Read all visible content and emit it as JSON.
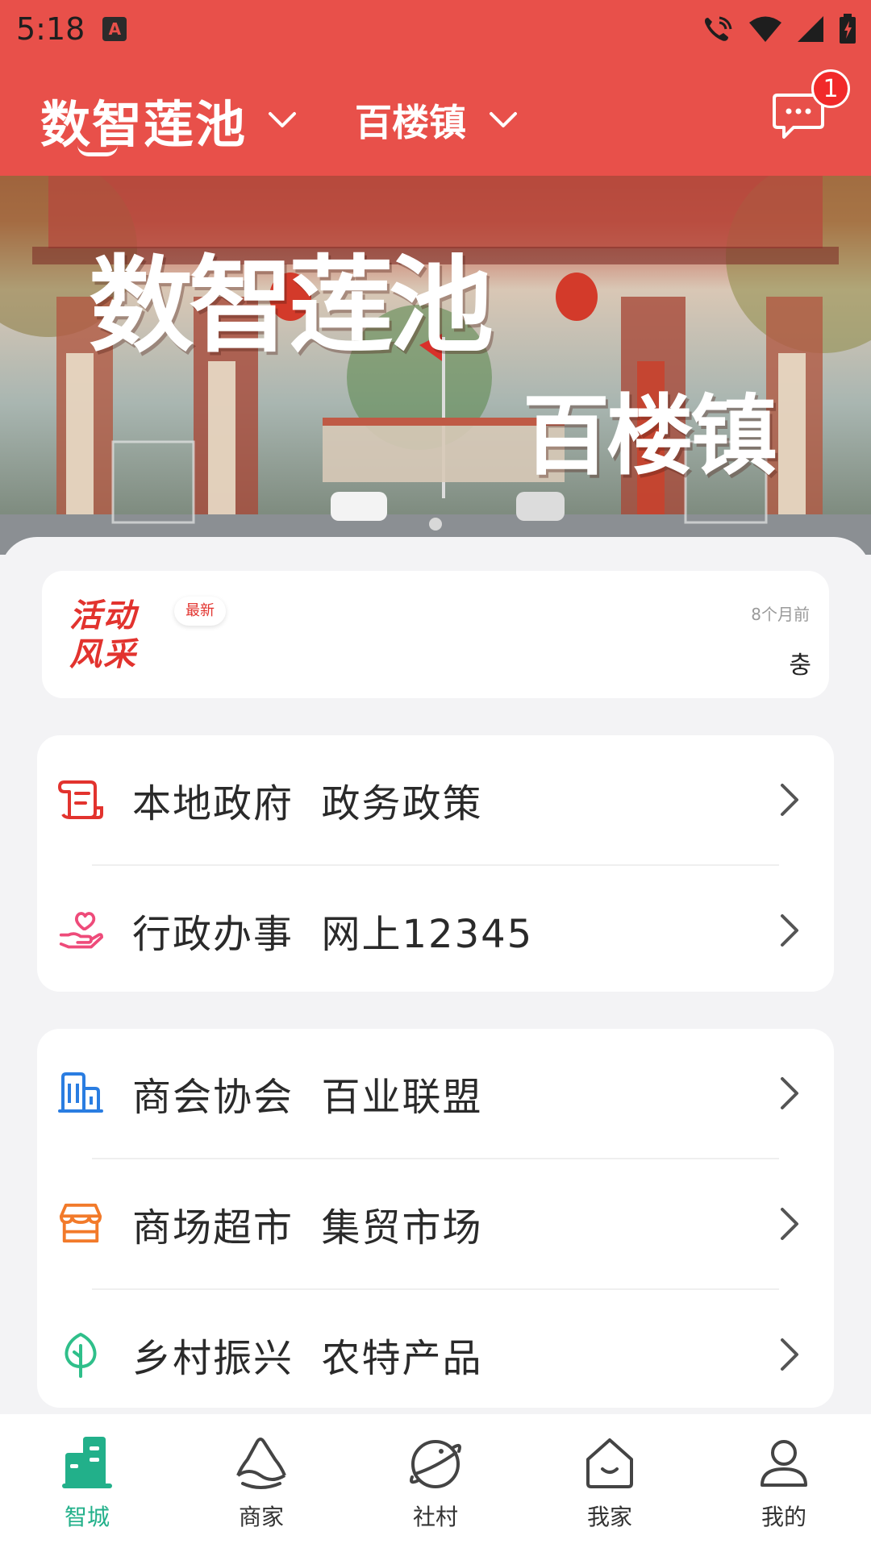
{
  "status_bar": {
    "time": "5:18",
    "app_icon_letter": "A"
  },
  "header": {
    "city": "数智莲池",
    "town": "百楼镇",
    "message_badge": "1"
  },
  "banner": {
    "title": "数智莲池",
    "subtitle": "百楼镇"
  },
  "news": {
    "logo_line1": "活动",
    "logo_line2": "风采",
    "badge": "最新",
    "time": "8个月前",
    "text": "충"
  },
  "menu_group_1": [
    {
      "label": "本地政府  政务政策",
      "icon": "government-document-icon"
    },
    {
      "label": "行政办事  网上12345",
      "icon": "heart-hand-icon"
    }
  ],
  "menu_group_2": [
    {
      "label": "商会协会  百业联盟",
      "icon": "building-icon"
    },
    {
      "label": "商场超市  集贸市场",
      "icon": "store-icon"
    },
    {
      "label": "乡村振兴  农特产品",
      "icon": "tree-icon"
    }
  ],
  "bottom_nav": [
    {
      "label": "智城",
      "active": true
    },
    {
      "label": "商家",
      "active": false
    },
    {
      "label": "社村",
      "active": false
    },
    {
      "label": "我家",
      "active": false
    },
    {
      "label": "我的",
      "active": false
    }
  ],
  "colors": {
    "brand_red": "#e8504a",
    "accent_green": "#22b08a",
    "icon_red": "#e2332e",
    "icon_pink": "#ee4b7a",
    "icon_blue": "#2a7de1",
    "icon_orange": "#f27a2a",
    "icon_green": "#2fbf8a"
  }
}
